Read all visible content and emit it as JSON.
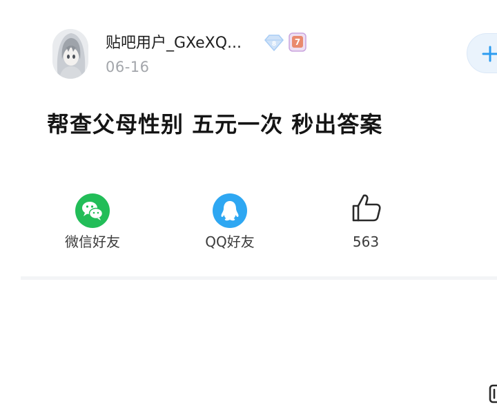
{
  "post": {
    "author": {
      "username": "贴吧用户_GXeXQ...",
      "diamond_level": "8",
      "user_level": "7"
    },
    "date": "06-16",
    "title": "帮查父母性别 五元一次 秒出答案"
  },
  "share_bar": {
    "wechat_label": "微信好友",
    "qq_label": "QQ好友",
    "like_count": "563"
  },
  "colors": {
    "wechat_green": "#22bd58",
    "qq_blue": "#2ea7f2",
    "follow_bg": "#eaf3fc",
    "follow_plus": "#2c9cf0",
    "date_gray": "#a3a6ab",
    "diamond_blue": "#a9cdf5",
    "level_purple": "#b489d8"
  },
  "icons": {
    "avatar": "anime-avatar",
    "diamond": "diamond-icon",
    "level": "level-badge-icon",
    "follow": "plus-icon",
    "wechat": "wechat-icon",
    "qq": "qq-icon",
    "like": "thumbs-up-icon"
  }
}
